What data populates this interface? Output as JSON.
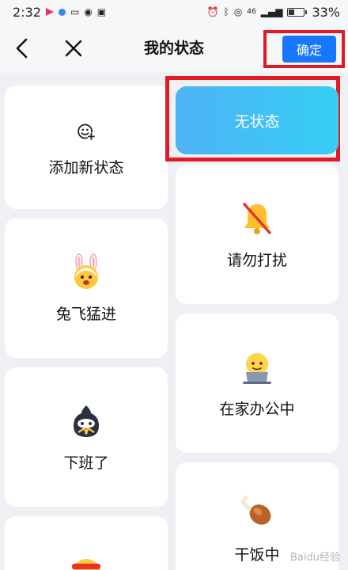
{
  "status_bar": {
    "time": "2:32",
    "battery": "33%",
    "signal_label": "46"
  },
  "header": {
    "title": "我的状态",
    "confirm_label": "确定"
  },
  "left_column": [
    {
      "label": "添加新状态",
      "icon": "add-emoji-icon"
    },
    {
      "label": "兔飞猛进",
      "icon": "rabbit-face-icon"
    },
    {
      "label": "下班了",
      "icon": "ninja-face-icon"
    },
    {
      "label": "",
      "icon": "headband-face-icon"
    }
  ],
  "right_column": [
    {
      "label": "无状态",
      "selected": true
    },
    {
      "label": "请勿打扰",
      "icon": "muted-bell-icon"
    },
    {
      "label": "在家办公中",
      "icon": "laptop-face-icon"
    },
    {
      "label": "干饭中",
      "icon": "drumstick-icon"
    }
  ],
  "watermark": "Baidu经验",
  "colors": {
    "accent": "#1677ff",
    "highlight": "#e01b24",
    "selected_gradient_start": "#4eb3f6",
    "selected_gradient_end": "#36cdf4"
  }
}
